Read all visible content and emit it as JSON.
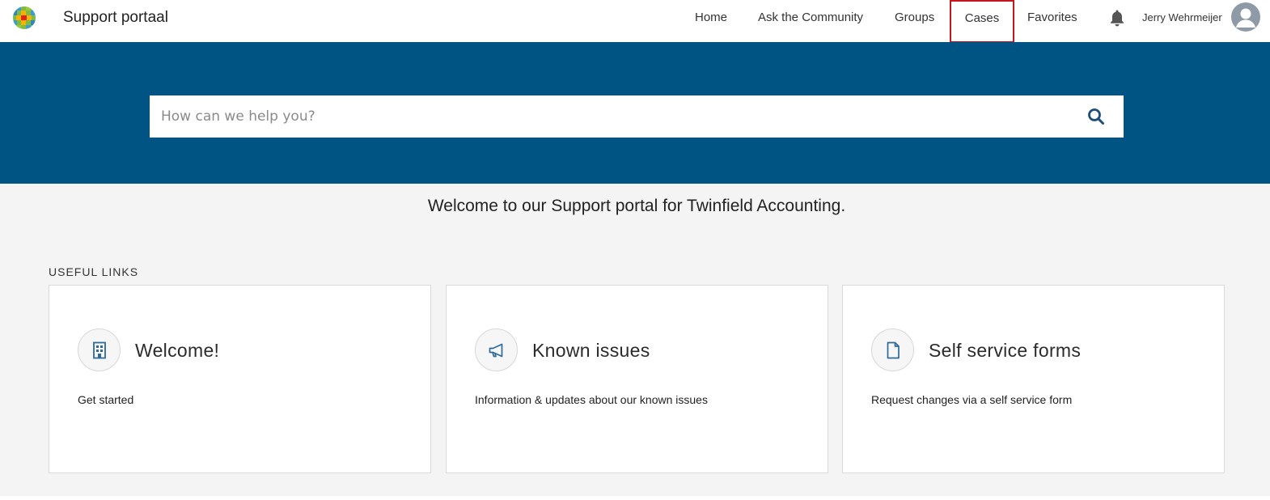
{
  "header": {
    "brand": "Support portaal",
    "nav": {
      "home": "Home",
      "community": "Ask the Community",
      "groups": "Groups",
      "cases": "Cases",
      "favorites": "Favorites"
    },
    "user_name": "Jerry Wehrmeijer",
    "highlight_color": "#c4161c"
  },
  "search": {
    "placeholder": "How can we help you?"
  },
  "hero_color": "#005484",
  "welcome_text": "Welcome to our Support portal for Twinfield Accounting.",
  "useful_links": {
    "label": "USEFUL LINKS",
    "cards": [
      {
        "title": "Welcome!",
        "description": "Get started",
        "icon": "building-icon"
      },
      {
        "title": "Known issues",
        "description": "Information & updates about our known issues",
        "icon": "megaphone-icon"
      },
      {
        "title": "Self service forms",
        "description": "Request changes via a self service form",
        "icon": "document-icon"
      }
    ]
  }
}
